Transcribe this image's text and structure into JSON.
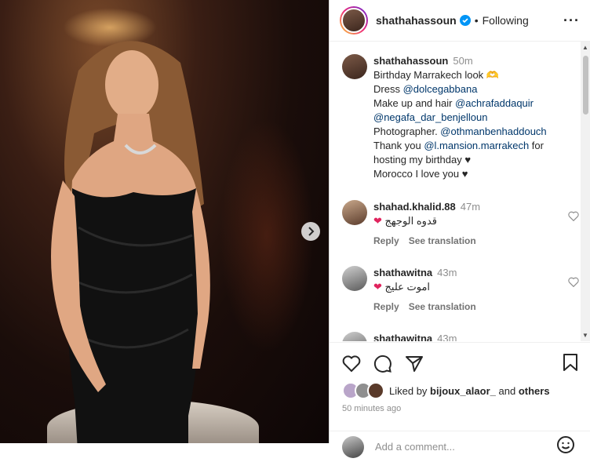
{
  "post": {
    "username": "shathahassoun",
    "following": "Following",
    "caption": {
      "time": "50m",
      "lines": [
        {
          "text": "Birthday Marrakech look 🫶"
        },
        {
          "prefix": "Dress ",
          "mention": "@dolcegabbana"
        },
        {
          "prefix": "Make up and hair ",
          "mention": "@achrafaddaquir"
        },
        {
          "prefix": "",
          "mention": "@negafa_dar_benjelloun"
        },
        {
          "prefix": "Photographer. ",
          "mention": "@othmanbenhaddouch"
        },
        {
          "prefix": "Thank you ",
          "mention": "@l.mansion.marrakech",
          "suffix": " for"
        },
        {
          "text": "hosting my birthday ♥"
        },
        {
          "text": "Morocco I love you ♥"
        }
      ]
    },
    "comments": [
      {
        "username": "shahad.khalid.88",
        "time": "47m",
        "text": "قدوه الوجهج",
        "reply": "Reply",
        "translate": "See translation"
      },
      {
        "username": "shathawitna",
        "time": "43m",
        "text": "اموت عليج",
        "reply": "Reply",
        "translate": "See translation"
      },
      {
        "username": "shathawitna",
        "time": "43m",
        "text": "",
        "reply": "",
        "translate": ""
      }
    ],
    "liked_by": {
      "prefix": "Liked by ",
      "user": "bijoux_alaor_",
      "middle": " and ",
      "others": "others"
    },
    "posted_ago": "50 minutes ago",
    "add_comment_placeholder": "Add a comment..."
  },
  "colors": {
    "verified": "#0095f6",
    "heart_red": "#e0245e",
    "link": "#00376b"
  }
}
